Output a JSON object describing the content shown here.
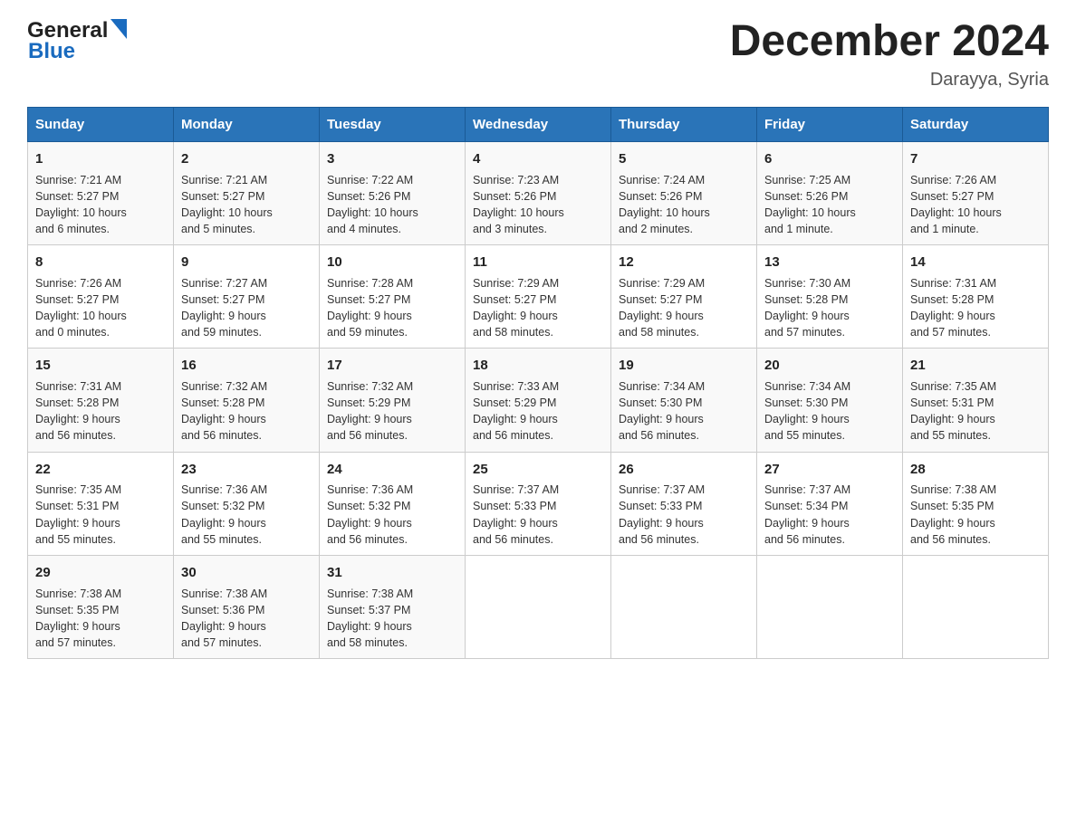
{
  "header": {
    "logo_general": "General",
    "logo_blue": "Blue",
    "month_title": "December 2024",
    "location": "Darayya, Syria"
  },
  "days_of_week": [
    "Sunday",
    "Monday",
    "Tuesday",
    "Wednesday",
    "Thursday",
    "Friday",
    "Saturday"
  ],
  "weeks": [
    [
      {
        "day": "1",
        "info": "Sunrise: 7:21 AM\nSunset: 5:27 PM\nDaylight: 10 hours\nand 6 minutes."
      },
      {
        "day": "2",
        "info": "Sunrise: 7:21 AM\nSunset: 5:27 PM\nDaylight: 10 hours\nand 5 minutes."
      },
      {
        "day": "3",
        "info": "Sunrise: 7:22 AM\nSunset: 5:26 PM\nDaylight: 10 hours\nand 4 minutes."
      },
      {
        "day": "4",
        "info": "Sunrise: 7:23 AM\nSunset: 5:26 PM\nDaylight: 10 hours\nand 3 minutes."
      },
      {
        "day": "5",
        "info": "Sunrise: 7:24 AM\nSunset: 5:26 PM\nDaylight: 10 hours\nand 2 minutes."
      },
      {
        "day": "6",
        "info": "Sunrise: 7:25 AM\nSunset: 5:26 PM\nDaylight: 10 hours\nand 1 minute."
      },
      {
        "day": "7",
        "info": "Sunrise: 7:26 AM\nSunset: 5:27 PM\nDaylight: 10 hours\nand 1 minute."
      }
    ],
    [
      {
        "day": "8",
        "info": "Sunrise: 7:26 AM\nSunset: 5:27 PM\nDaylight: 10 hours\nand 0 minutes."
      },
      {
        "day": "9",
        "info": "Sunrise: 7:27 AM\nSunset: 5:27 PM\nDaylight: 9 hours\nand 59 minutes."
      },
      {
        "day": "10",
        "info": "Sunrise: 7:28 AM\nSunset: 5:27 PM\nDaylight: 9 hours\nand 59 minutes."
      },
      {
        "day": "11",
        "info": "Sunrise: 7:29 AM\nSunset: 5:27 PM\nDaylight: 9 hours\nand 58 minutes."
      },
      {
        "day": "12",
        "info": "Sunrise: 7:29 AM\nSunset: 5:27 PM\nDaylight: 9 hours\nand 58 minutes."
      },
      {
        "day": "13",
        "info": "Sunrise: 7:30 AM\nSunset: 5:28 PM\nDaylight: 9 hours\nand 57 minutes."
      },
      {
        "day": "14",
        "info": "Sunrise: 7:31 AM\nSunset: 5:28 PM\nDaylight: 9 hours\nand 57 minutes."
      }
    ],
    [
      {
        "day": "15",
        "info": "Sunrise: 7:31 AM\nSunset: 5:28 PM\nDaylight: 9 hours\nand 56 minutes."
      },
      {
        "day": "16",
        "info": "Sunrise: 7:32 AM\nSunset: 5:28 PM\nDaylight: 9 hours\nand 56 minutes."
      },
      {
        "day": "17",
        "info": "Sunrise: 7:32 AM\nSunset: 5:29 PM\nDaylight: 9 hours\nand 56 minutes."
      },
      {
        "day": "18",
        "info": "Sunrise: 7:33 AM\nSunset: 5:29 PM\nDaylight: 9 hours\nand 56 minutes."
      },
      {
        "day": "19",
        "info": "Sunrise: 7:34 AM\nSunset: 5:30 PM\nDaylight: 9 hours\nand 56 minutes."
      },
      {
        "day": "20",
        "info": "Sunrise: 7:34 AM\nSunset: 5:30 PM\nDaylight: 9 hours\nand 55 minutes."
      },
      {
        "day": "21",
        "info": "Sunrise: 7:35 AM\nSunset: 5:31 PM\nDaylight: 9 hours\nand 55 minutes."
      }
    ],
    [
      {
        "day": "22",
        "info": "Sunrise: 7:35 AM\nSunset: 5:31 PM\nDaylight: 9 hours\nand 55 minutes."
      },
      {
        "day": "23",
        "info": "Sunrise: 7:36 AM\nSunset: 5:32 PM\nDaylight: 9 hours\nand 55 minutes."
      },
      {
        "day": "24",
        "info": "Sunrise: 7:36 AM\nSunset: 5:32 PM\nDaylight: 9 hours\nand 56 minutes."
      },
      {
        "day": "25",
        "info": "Sunrise: 7:37 AM\nSunset: 5:33 PM\nDaylight: 9 hours\nand 56 minutes."
      },
      {
        "day": "26",
        "info": "Sunrise: 7:37 AM\nSunset: 5:33 PM\nDaylight: 9 hours\nand 56 minutes."
      },
      {
        "day": "27",
        "info": "Sunrise: 7:37 AM\nSunset: 5:34 PM\nDaylight: 9 hours\nand 56 minutes."
      },
      {
        "day": "28",
        "info": "Sunrise: 7:38 AM\nSunset: 5:35 PM\nDaylight: 9 hours\nand 56 minutes."
      }
    ],
    [
      {
        "day": "29",
        "info": "Sunrise: 7:38 AM\nSunset: 5:35 PM\nDaylight: 9 hours\nand 57 minutes."
      },
      {
        "day": "30",
        "info": "Sunrise: 7:38 AM\nSunset: 5:36 PM\nDaylight: 9 hours\nand 57 minutes."
      },
      {
        "day": "31",
        "info": "Sunrise: 7:38 AM\nSunset: 5:37 PM\nDaylight: 9 hours\nand 58 minutes."
      },
      {
        "day": "",
        "info": ""
      },
      {
        "day": "",
        "info": ""
      },
      {
        "day": "",
        "info": ""
      },
      {
        "day": "",
        "info": ""
      }
    ]
  ],
  "accent_color": "#2a74b8"
}
